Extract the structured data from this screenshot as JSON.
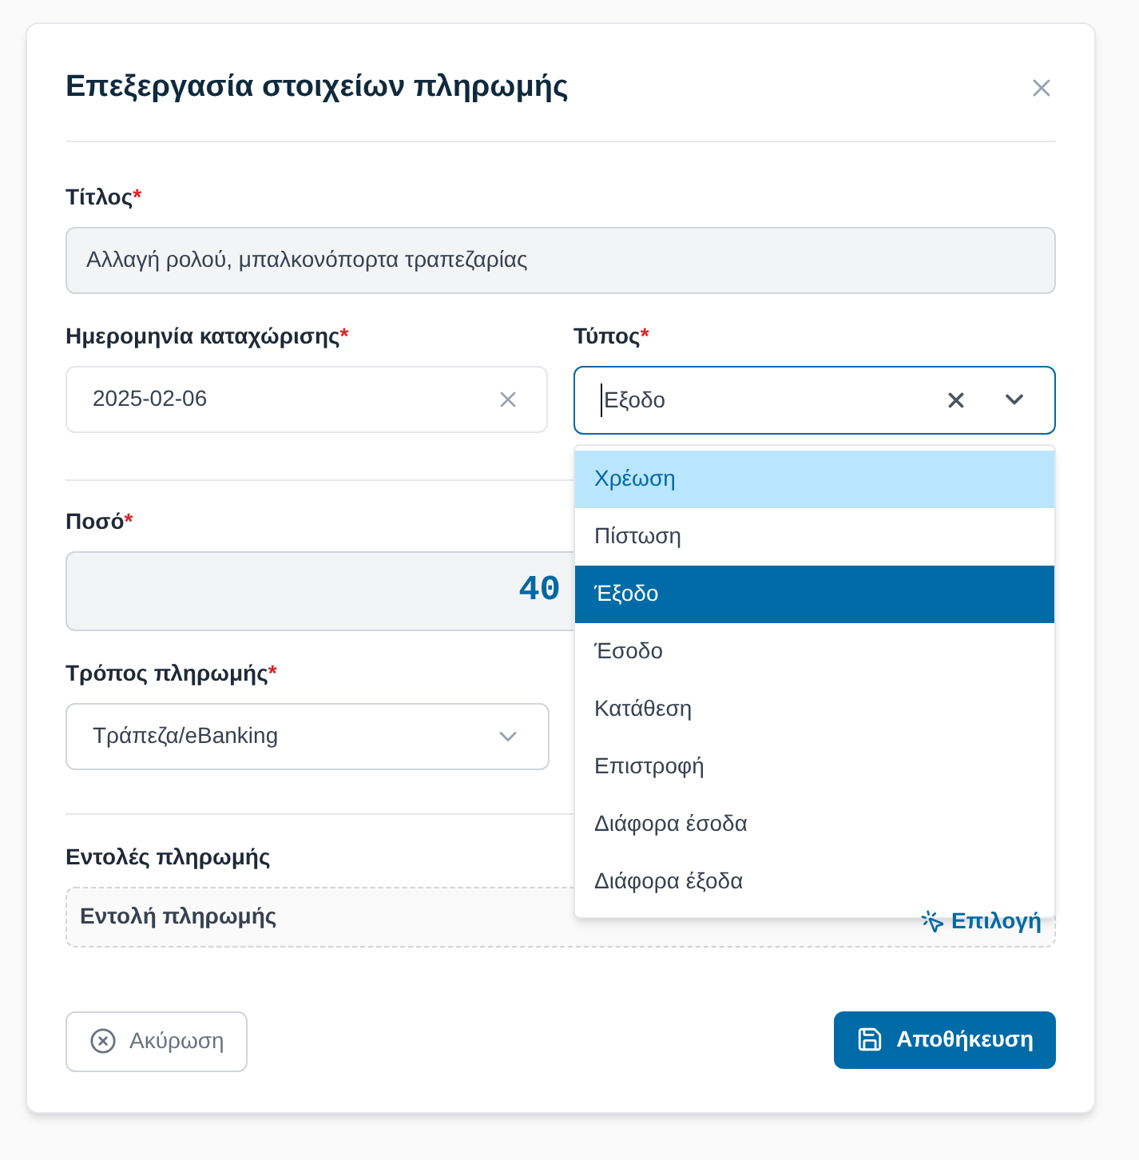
{
  "dialog": {
    "title": "Επεξεργασία στοιχείων πληρωμής"
  },
  "title_field": {
    "label": "Τίτλος",
    "required_mark": "*",
    "value": "Αλλαγή ρολού, μπαλκονόπορτα τραπεζαρίας"
  },
  "date_field": {
    "label": "Ημερομηνία καταχώρισης",
    "required_mark": "*",
    "value": "2025-02-06"
  },
  "type_field": {
    "label": "Τύπος",
    "required_mark": "*",
    "value": "Εξοδο",
    "expanded": true,
    "options": [
      {
        "label": "Χρέωση",
        "selected": false,
        "hovered": true
      },
      {
        "label": "Πίστωση",
        "selected": false,
        "hovered": false
      },
      {
        "label": "Έξοδο",
        "selected": true,
        "hovered": false
      },
      {
        "label": "Έσοδο",
        "selected": false,
        "hovered": false
      },
      {
        "label": "Κατάθεση",
        "selected": false,
        "hovered": false
      },
      {
        "label": "Επιστροφή",
        "selected": false,
        "hovered": false
      },
      {
        "label": "Διάφορα έσοδα",
        "selected": false,
        "hovered": false
      },
      {
        "label": "Διάφορα έξοδα",
        "selected": false,
        "hovered": false
      }
    ]
  },
  "amount_field": {
    "label": "Ποσό",
    "required_mark": "*",
    "value": "40"
  },
  "payment_method": {
    "label": "Τρόπος πληρωμής",
    "required_mark": "*",
    "value": "Τράπεζα/eBanking"
  },
  "payment_orders": {
    "label": "Εντολές πληρωμής",
    "item": "Εντολή πληρωμής",
    "action": "Επιλογή"
  },
  "buttons": {
    "cancel": "Ακύρωση",
    "save": "Αποθήκευση"
  }
}
